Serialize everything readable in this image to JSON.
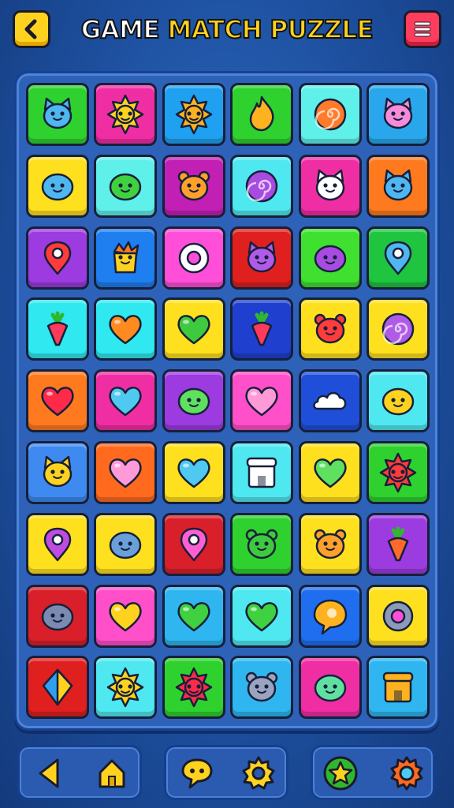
{
  "header": {
    "title_part1": "GAME",
    "title_part2": "MATCH PUZZLE",
    "back_icon": "chevron-left-icon",
    "menu_icon": "hamburger-menu-icon"
  },
  "board": {
    "rows": 9,
    "cols": 6,
    "tiles": [
      {
        "bg": "#2fd12f",
        "icon": "blue-cat-face",
        "fg": "#4fb6ef"
      },
      {
        "bg": "#f02ea4",
        "icon": "yellow-star-face",
        "fg": "#ffd21f"
      },
      {
        "bg": "#1fa0f0",
        "icon": "orange-sun-face",
        "fg": "#ffb21f"
      },
      {
        "bg": "#2fd12f",
        "icon": "orange-flame",
        "fg": "#ffb21f"
      },
      {
        "bg": "#5ff0ea",
        "icon": "orange-swirl-candy",
        "fg": "#ff7a2a"
      },
      {
        "bg": "#2aa7ec",
        "icon": "pink-pig-face",
        "fg": "#f58bd9"
      },
      {
        "bg": "#ffe01f",
        "icon": "blue-round-face",
        "fg": "#4fb6ef"
      },
      {
        "bg": "#5ff0ea",
        "icon": "green-blob-face",
        "fg": "#3fd13f"
      },
      {
        "bg": "#c21fb5",
        "icon": "orange-bear-face",
        "fg": "#ffa02a"
      },
      {
        "bg": "#4fe8f0",
        "icon": "purple-swirl-candy",
        "fg": "#a84be0"
      },
      {
        "bg": "#f02ea4",
        "icon": "white-cat-face",
        "fg": "#ffffff"
      },
      {
        "bg": "#ff7a1f",
        "icon": "blue-cat-face",
        "fg": "#4fb6ef"
      },
      {
        "bg": "#9b3be0",
        "icon": "red-map-pin",
        "fg": "#ff3b3b"
      },
      {
        "bg": "#1f7ef0",
        "icon": "yellow-crown-face",
        "fg": "#ffd21f"
      },
      {
        "bg": "#ff4fd9",
        "icon": "white-gear-ring",
        "fg": "#ffffff"
      },
      {
        "bg": "#e01f1f",
        "icon": "purple-cat-face",
        "fg": "#b05be8"
      },
      {
        "bg": "#3fe02f",
        "icon": "purple-bird-face",
        "fg": "#a84be0"
      },
      {
        "bg": "#1fc43f",
        "icon": "blue-pin-bubble",
        "fg": "#4fb6ef"
      },
      {
        "bg": "#2fe8f0",
        "icon": "red-radish",
        "fg": "#ff3b5b"
      },
      {
        "bg": "#2fe8f0",
        "icon": "orange-heart",
        "fg": "#ff8a1f"
      },
      {
        "bg": "#ffe01f",
        "icon": "green-leaf-heart",
        "fg": "#3fc93f"
      },
      {
        "bg": "#1f3fcf",
        "icon": "red-radish",
        "fg": "#ff3b5b"
      },
      {
        "bg": "#ffe01f",
        "icon": "red-bear-face",
        "fg": "#ff3b3b"
      },
      {
        "bg": "#ffe01f",
        "icon": "purple-swirl-bubble",
        "fg": "#b05be8"
      },
      {
        "bg": "#ff7a1f",
        "icon": "red-heart",
        "fg": "#ff2a4a"
      },
      {
        "bg": "#f02ea4",
        "icon": "blue-heart",
        "fg": "#4fc9f0"
      },
      {
        "bg": "#9b3be0",
        "icon": "green-round-face",
        "fg": "#5fe05f"
      },
      {
        "bg": "#ff4fc9",
        "icon": "pink-heart",
        "fg": "#ff9ad9"
      },
      {
        "bg": "#1f4fd9",
        "icon": "white-cloud",
        "fg": "#ffffff"
      },
      {
        "bg": "#4fe8f0",
        "icon": "yellow-blob-face",
        "fg": "#ffd21f"
      },
      {
        "bg": "#3f8af0",
        "icon": "yellow-cat-face",
        "fg": "#ffd21f"
      },
      {
        "bg": "#ff6a1f",
        "icon": "pink-heart",
        "fg": "#ff9ad9"
      },
      {
        "bg": "#ffe01f",
        "icon": "blue-heart",
        "fg": "#4fc9f0"
      },
      {
        "bg": "#4fe8f0",
        "icon": "white-house-block",
        "fg": "#ffffff"
      },
      {
        "bg": "#ffe01f",
        "icon": "green-heart-star",
        "fg": "#5fe05f"
      },
      {
        "bg": "#2fd12f",
        "icon": "red-star-face",
        "fg": "#ff3b3b"
      },
      {
        "bg": "#ffe01f",
        "icon": "purple-map-pin",
        "fg": "#c04be0"
      },
      {
        "bg": "#ffe01f",
        "icon": "blue-seal-face",
        "fg": "#6aa0d9"
      },
      {
        "bg": "#d91f2a",
        "icon": "pink-gem",
        "fg": "#ff5fd0"
      },
      {
        "bg": "#2fd12f",
        "icon": "green-frog-face",
        "fg": "#3fc93f"
      },
      {
        "bg": "#ffe01f",
        "icon": "orange-bear-face",
        "fg": "#ffa02a"
      },
      {
        "bg": "#9b3be0",
        "icon": "orange-carrot",
        "fg": "#ff6a2a"
      },
      {
        "bg": "#d91f2a",
        "icon": "gray-seal-face",
        "fg": "#7a8ab0"
      },
      {
        "bg": "#ff4fc9",
        "icon": "yellow-heart",
        "fg": "#ffd21f"
      },
      {
        "bg": "#2fb6f0",
        "icon": "green-heart",
        "fg": "#3fd13f"
      },
      {
        "bg": "#4fe8f0",
        "icon": "green-heart",
        "fg": "#3fd13f"
      },
      {
        "bg": "#1f6ef0",
        "icon": "orange-bubble",
        "fg": "#ffb21f"
      },
      {
        "bg": "#ffe01f",
        "icon": "gray-ring",
        "fg": "#8a9ab8"
      },
      {
        "bg": "#e01f1f",
        "icon": "blue-yellow-kite",
        "fg": "#2fa0f0"
      },
      {
        "bg": "#4fe8f0",
        "icon": "yellow-sunflower",
        "fg": "#ffd21f"
      },
      {
        "bg": "#2fd12f",
        "icon": "red-flower-face",
        "fg": "#ff2a4a"
      },
      {
        "bg": "#2fb6f0",
        "icon": "gray-mouse-face",
        "fg": "#9aa4c0"
      },
      {
        "bg": "#f02ea4",
        "icon": "green-alien-face",
        "fg": "#5fe0a0"
      },
      {
        "bg": "#2fb6f0",
        "icon": "orange-hut",
        "fg": "#ffb21f"
      }
    ]
  },
  "bottom_bar": {
    "panels": [
      {
        "buttons": [
          {
            "icon": "arrow-left-icon",
            "color": "#ffd21f"
          },
          {
            "icon": "home-icon",
            "color": "#ffd21f"
          }
        ]
      },
      {
        "buttons": [
          {
            "icon": "chat-bubble-icon",
            "color": "#ffd21f"
          },
          {
            "icon": "settings-sun-icon",
            "color": "#ffd21f"
          }
        ]
      },
      {
        "buttons": [
          {
            "icon": "star-badge-icon",
            "color": "#ffd21f"
          },
          {
            "icon": "gear-icon",
            "color": "#ff6a1f"
          }
        ]
      }
    ]
  }
}
